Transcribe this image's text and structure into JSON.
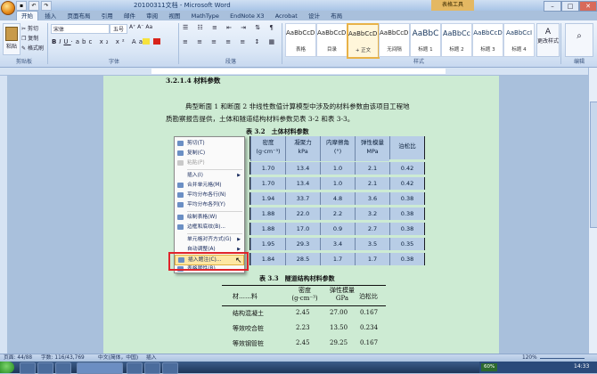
{
  "window": {
    "title": "20100311文档 - Microsoft Word",
    "context_tab_label": "表格工具",
    "controls": [
      "–",
      "□",
      "✕"
    ]
  },
  "ribbon_tabs": [
    "开始",
    "插入",
    "页面布局",
    "引用",
    "邮件",
    "审阅",
    "视图",
    "MathType",
    "EndNote X3",
    "Acrobat",
    "设计",
    "布局"
  ],
  "ribbon": {
    "clipboard": {
      "group_label": "剪贴板",
      "paste": "粘贴",
      "cut": "剪切",
      "copy": "复制",
      "format_painter": "格式刷"
    },
    "font": {
      "group_label": "字体",
      "font_name": "宋体",
      "font_size": "五号"
    },
    "paragraph": {
      "group_label": "段落"
    },
    "styles": {
      "group_label": "样式",
      "items": [
        {
          "sample": "AaBbCcDi",
          "name": "表格"
        },
        {
          "sample": "AaBbCcDi",
          "name": "目录"
        },
        {
          "sample": "AaBbCcDi",
          "name": "+ 正文"
        },
        {
          "sample": "AaBbCcDi",
          "name": "无间隔"
        },
        {
          "sample": "AaBbC",
          "name": "标题 1"
        },
        {
          "sample": "AaBbCc",
          "name": "标题 2"
        },
        {
          "sample": "AaBbCcD",
          "name": "标题 3"
        },
        {
          "sample": "AaBbCcI",
          "name": "标题 4"
        }
      ],
      "change_styles": "更改样式"
    },
    "editing": {
      "group_label": "编辑"
    }
  },
  "document": {
    "heading": "3.2.1.4 材料参数",
    "paragraph_line1": "典型断面 1 和断面 2 非线性数值计算模型中涉及的材料参数由该项目工程地",
    "paragraph_line2": "质勘察报告提供，土体和隧道结构材料参数见表 3-2 和表 3-3。",
    "table1": {
      "caption": "表 3.2　土体材料参数",
      "headers": [
        "密度",
        "凝聚力",
        "内摩擦角",
        "弹性模量",
        "泊松比"
      ],
      "header_units": [
        "(g·cm⁻³)",
        "kPa",
        "(°)",
        "MPa",
        ""
      ],
      "rows": [
        [
          "1.70",
          "13.4",
          "1.0",
          "2.1",
          "0.42"
        ],
        [
          "1.70",
          "13.4",
          "1.0",
          "2.1",
          "0.42"
        ],
        [
          "1.94",
          "33.7",
          "4.8",
          "3.6",
          "0.38"
        ],
        [
          "1.88",
          "22.0",
          "2.2",
          "3.2",
          "0.38"
        ],
        [
          "1.88",
          "17.0",
          "0.9",
          "2.7",
          "0.38"
        ],
        [
          "1.95",
          "29.3",
          "3.4",
          "3.5",
          "0.35"
        ],
        [
          "1.84",
          "28.5",
          "1.7",
          "1.7",
          "0.38"
        ]
      ]
    },
    "table2": {
      "caption": "表 3.3　隧道结构材料参数",
      "headers": [
        "材……料",
        "密度",
        "弹性模量",
        "泊松比"
      ],
      "header_units": [
        "",
        "(g·cm⁻³)",
        "GPa",
        ""
      ],
      "rows": [
        [
          "结构混凝土",
          "2.45",
          "27.00",
          "0.167"
        ],
        [
          "等效咬合桩",
          "2.23",
          "13.50",
          "0.234"
        ],
        [
          "等效钢管桩",
          "2.45",
          "29.25",
          "0.167"
        ]
      ]
    }
  },
  "context_menu": {
    "items": [
      {
        "label": "剪切(T)",
        "icon": "scissors-icon",
        "disabled": false
      },
      {
        "label": "复制(C)",
        "icon": "copy-icon",
        "disabled": false
      },
      {
        "label": "粘贴(P)",
        "icon": "paste-icon",
        "disabled": true
      },
      {
        "label": "插入(I)",
        "icon": "",
        "disabled": false,
        "submenu": true
      },
      {
        "label": "合并单元格(M)",
        "icon": "merge-cells-icon",
        "disabled": false
      },
      {
        "label": "平均分布各行(N)",
        "icon": "distribute-rows-icon",
        "disabled": false
      },
      {
        "label": "平均分布各列(Y)",
        "icon": "distribute-columns-icon",
        "disabled": false
      },
      {
        "label": "绘制表格(W)",
        "icon": "draw-table-icon",
        "disabled": false
      },
      {
        "label": "边框和底纹(B)...",
        "icon": "borders-icon",
        "disabled": false
      },
      {
        "label": "单元格对齐方式(G)",
        "icon": "",
        "disabled": false,
        "submenu": true
      },
      {
        "label": "自动调整(A)",
        "icon": "",
        "disabled": false,
        "submenu": true
      },
      {
        "label": "插入题注(C)...",
        "icon": "insert-caption-icon",
        "disabled": false,
        "highlighted": true
      },
      {
        "label": "表格属性(R)...",
        "icon": "table-properties-icon",
        "disabled": false
      }
    ]
  },
  "statusbar": {
    "page": "页面: 44/88",
    "words": "字数: 116/43,769",
    "language": "中文(简体，中国)",
    "mode": "插入",
    "zoom": "120%"
  },
  "taskbar": {
    "clock": "14:33",
    "tray_percent": "60%"
  }
}
